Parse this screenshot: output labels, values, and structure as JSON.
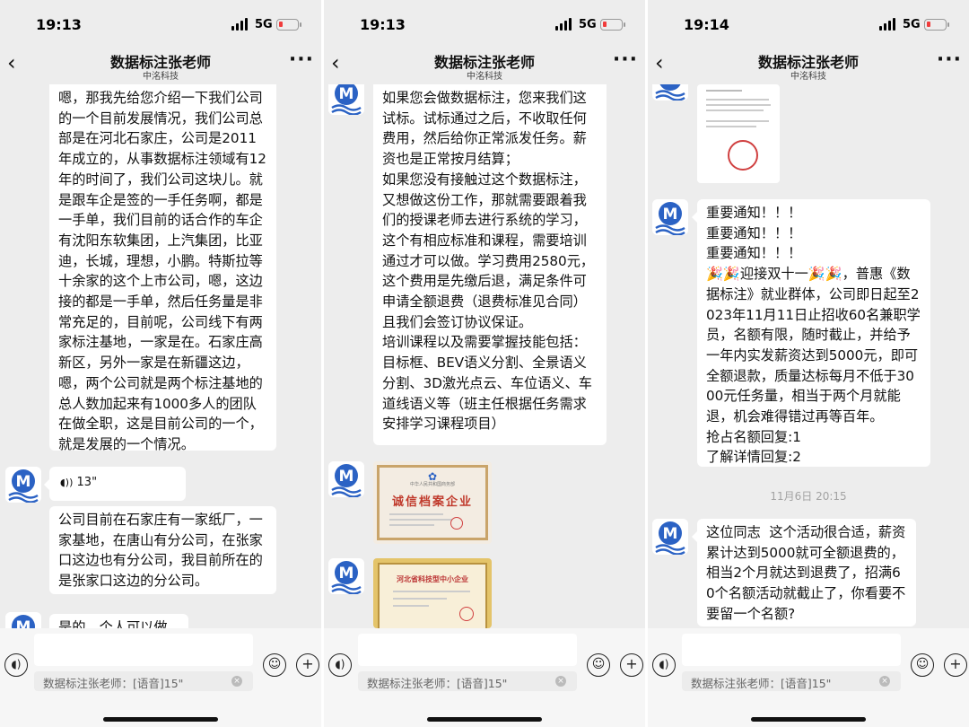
{
  "common": {
    "title": "数据标注张老师",
    "subtitle": "中洺科技",
    "network": "5G",
    "back_icon": "‹",
    "more_icon": "···",
    "quote": "数据标注张老师：[语音]15\"",
    "colors": {
      "bg": "#ededed",
      "bubble": "#ffffff",
      "battery_low": "#f03c3c",
      "logo_blue": "#2b62c4"
    }
  },
  "panels": [
    {
      "time": "19:13",
      "messages": [
        "嗯，那我先给您介绍一下我们公司的一个目前发展情况，我们公司总部是在河北石家庄，公司是2011年成立的，从事数据标注领域有12年的时间了，我们公司这块儿。就是跟车企是签的一手任务啊，都是一手单，我们目前的话合作的车企有沈阳东软集团，上汽集团，比亚迪，长城，理想，小鹏。特斯拉等十余家的这个上市公司，嗯，这边接的都是一手单，然后任务量是非常充足的，目前呢，公司线下有两家标注基地，一家是在。石家庄高新区，另外一家是在新疆这边，嗯，两个公司就是两个标注基地的总人数加起来有1000多人的团队在做全职，这是目前公司的一个，就是发展的一个情况。",
        "13\"",
        "公司目前在石家庄有一家纸厂，一家基地，在唐山有分公司，在张家口这边也有分公司，我目前所在的是张家口这边的分公司。",
        "是的，个人可以做"
      ]
    },
    {
      "time": "19:13",
      "messages": [
        "如果您会做数据标注，您来我们这试标。试标通过之后，不收取任何费用，然后给你正常派发任务。薪资也是正常按月结算；\n如果您没有接触过这个数据标注，又想做这份工作，那就需要跟着我们的授课老师去进行系统的学习，这个有相应标准和课程，需要培训通过才可以做。学习费用2580元，这个费用是先缴后退，满足条件可申请全额退费（退费标准见合同）且我们会签订协议保证。\n培训课程以及需要掌握技能包括：目标框、BEV语义分割、全景语义分割、3D激光点云、车位语义、车道线语义等（班主任根据任务需求安排学习课程项目）"
      ],
      "certificates": [
        {
          "title": "诚信档案企业",
          "issuer": "中华人民共和国商务部"
        },
        {
          "title": "河北省科技型中小企业"
        }
      ]
    },
    {
      "time": "19:14",
      "messages": [
        "重要通知！！！\n重要通知！！！\n重要通知！！！\n🎉🎉迎接双十一🎉🎉，普惠《数据标注》就业群体，公司即日起至2023年11月11日止招收60名兼职学员，名额有限，随时截止，并给予一年内实发薪资达到5000元，即可全额退款，质量达标每月不低于3000元任务量，相当于两个月就能退，机会难得错过再等百年。\n抢占名额回复:1\n了解详情回复:2",
        "11月6日 20:15",
        "这位同志  这个活动很合适，薪资累计达到5000就可全额退费的，相当2个月就达到退费了，招满60个名额活动就截止了，你看要不要留一个名额?"
      ]
    }
  ]
}
